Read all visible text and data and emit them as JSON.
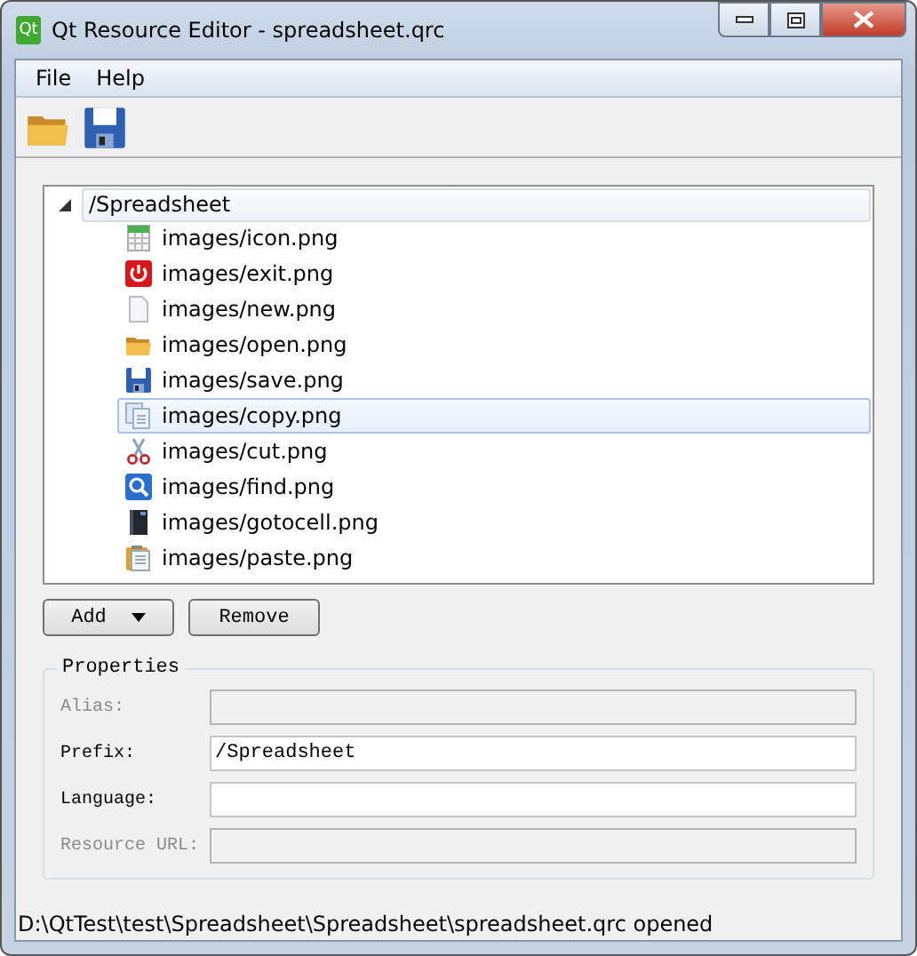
{
  "window": {
    "title": "Qt Resource Editor - spreadsheet.qrc",
    "app_icon": "Qt"
  },
  "menu": [
    {
      "label": "File"
    },
    {
      "label": "Help"
    }
  ],
  "toolbar": [
    {
      "kind": "folder"
    },
    {
      "kind": "disk"
    }
  ],
  "tree": {
    "root": {
      "label": "/Spreadsheet",
      "expanded": true,
      "selected": false,
      "children": [
        {
          "label": "images/icon.png",
          "kind": "sheet",
          "selected": false
        },
        {
          "label": "images/exit.png",
          "kind": "power",
          "selected": false
        },
        {
          "label": "images/new.png",
          "kind": "page",
          "selected": false
        },
        {
          "label": "images/open.png",
          "kind": "folder",
          "selected": false
        },
        {
          "label": "images/save.png",
          "kind": "disk",
          "selected": false
        },
        {
          "label": "images/copy.png",
          "kind": "pages",
          "selected": true
        },
        {
          "label": "images/cut.png",
          "kind": "scissors",
          "selected": false
        },
        {
          "label": "images/find.png",
          "kind": "magnifier",
          "selected": false
        },
        {
          "label": "images/gotocell.png",
          "kind": "book",
          "selected": false
        },
        {
          "label": "images/paste.png",
          "kind": "clipboard",
          "selected": false
        }
      ]
    }
  },
  "buttons": [
    {
      "label": "Add",
      "dropdown": true
    },
    {
      "label": "Remove",
      "dropdown": false
    }
  ],
  "properties": {
    "title": "Properties",
    "fields": [
      {
        "label": "Alias:",
        "disabled": true
      },
      {
        "label": "Prefix:",
        "value": "/Spreadsheet",
        "disabled": false
      },
      {
        "label": "Language:",
        "disabled": false
      },
      {
        "label": "Resource URL:",
        "disabled": true
      }
    ]
  },
  "status_bar": "D:\\QtTest\\test\\Spreadsheet\\Spreadsheet\\spreadsheet.qrc opened"
}
